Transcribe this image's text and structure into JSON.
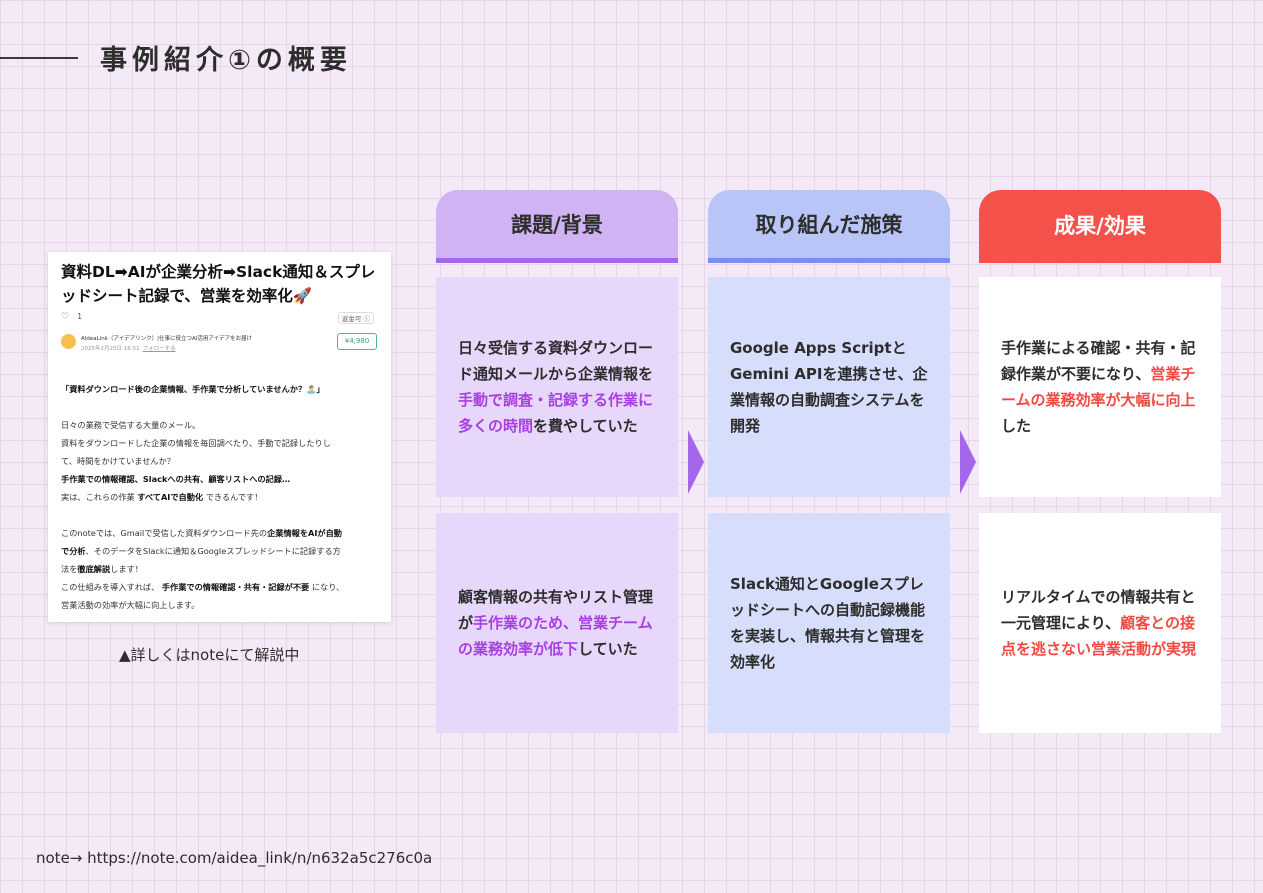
{
  "page": {
    "title": "事例紹介①の概要"
  },
  "note_card": {
    "title": "資料DL➡AIが企業分析➡Slack通知＆スプレッドシート記録で、営業を効率化🚀",
    "like_count": "1",
    "tip_label": "返金可 ⓘ",
    "author_name": "AIdeaLink（アイデアリンク）|仕事に役立つAI活用アイデアをお届け",
    "author_date": "2025年2月25日 16:51",
    "follow_label": "フォローする",
    "price": "¥4,980",
    "lead": "「資料ダウンロード後の企業情報、手作業で分析していませんか？🏝️」",
    "p1_line1": "日々の業務で受信する大量のメール。",
    "p1_line2": "資料をダウンロードした企業の情報を毎回調べたり、手動で記録したりし",
    "p1_line3": "て、時間をかけていませんか？",
    "p1_line4": "手作業での情報確認、Slackへの共有、顧客リストへの記録…",
    "p1_line5_pre": "実は、これらの作業 ",
    "p1_line5_bold": "すべてAIで自動化",
    "p1_line5_post": " できるんです！",
    "p2_line1_pre": "このnoteでは、Gmailで受信した資料ダウンロード先の",
    "p2_line1_bold": "企業情報をAIが自動",
    "p2_line2_bold": "で分析",
    "p2_line2_post": "、そのデータをSlackに通知＆Googleスプレッドシートに記録する方",
    "p2_line3_pre": "法を",
    "p2_line3_bold": "徹底解説",
    "p2_line3_post": "します！",
    "p3_line1_pre": "この仕組みを導入すれば、 ",
    "p3_line1_bold": "手作業での情報確認・共有・記録が不要",
    "p3_line1_post": " になり、",
    "p3_line2": "営業活動の効率が大幅に向上します。",
    "caption": "▲詳しくはnoteにて解説中"
  },
  "columns": {
    "issue": {
      "header": "課題/背景",
      "row1_a": "日々受信する資料ダウンロード通知メールから企業情報を",
      "row1_hl": "手動で調査・記録する作業に多くの時間",
      "row1_b": "を費やしていた",
      "row2_a": "顧客情報の共有やリスト管理が",
      "row2_hl": "手作業のため、営業チームの業務効率が低下",
      "row2_b": "していた"
    },
    "measure": {
      "header": "取り組んだ施策",
      "row1": "Google Apps ScriptとGemini APIを連携させ、企業情報の自動調査システムを開発",
      "row2": "Slack通知とGoogleスプレッドシートへの自動記録機能を実装し、情報共有と管理を効率化"
    },
    "result": {
      "header": "成果/効果",
      "row1_a": "手作業による確認・共有・記録作業が不要になり、",
      "row1_hl": "営業チームの業務効率が大幅に向上",
      "row1_b": "した",
      "row2_a": "リアルタイムでの情報共有と一元管理により、",
      "row2_hl": "顧客との接点を逃さない営業活動が実現",
      "row2_b": ""
    }
  },
  "footer": {
    "link": "note→ https://note.com/aidea_link/n/n632a5c276c0a"
  },
  "colors": {
    "issue_accent": "#a466ea",
    "measure_accent": "#7a8ef0",
    "result_accent": "#f5514b",
    "highlight_purple": "#a83fe0",
    "highlight_red": "#f04a43"
  },
  "icons": [
    "heart-icon",
    "info-icon",
    "arrow-right-icon"
  ]
}
